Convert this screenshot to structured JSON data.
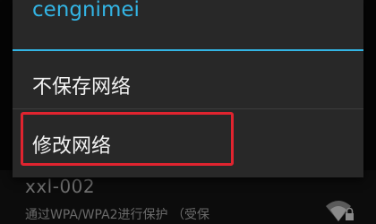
{
  "dialog": {
    "title": "cengnimei",
    "menu_items": [
      {
        "label": "不保存网络"
      },
      {
        "label": "修改网络"
      }
    ]
  },
  "background_list": {
    "ssid": "xxl-002",
    "security_text": "通过WPA/WPA2进行保护 （受保",
    "icon": "wifi-lock-icon"
  },
  "colors": {
    "accent": "#33b5e5",
    "dialog_bg": "#282828",
    "highlight": "#e0242f",
    "text": "#f2f2f2"
  }
}
